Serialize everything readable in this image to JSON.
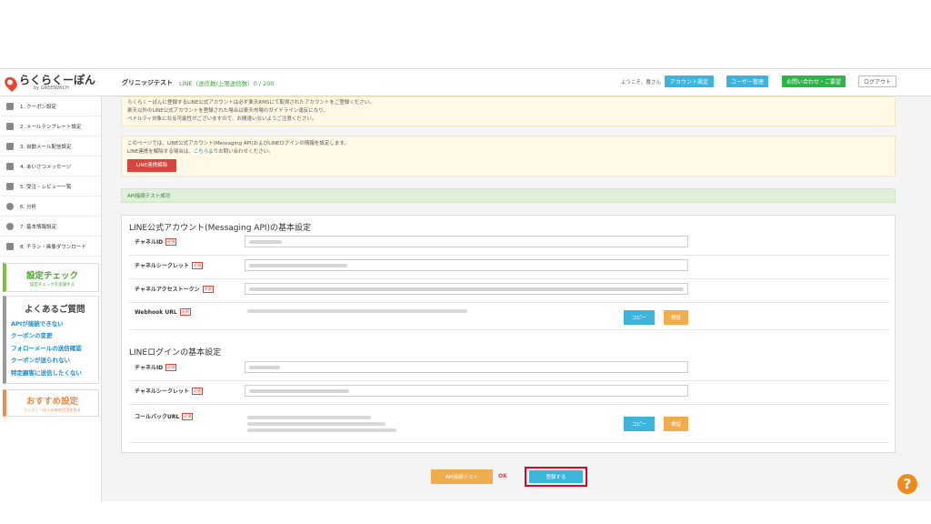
{
  "header": {
    "logo_text": "らくらくーぽん",
    "logo_sub": "by GREENWICH",
    "shop_name": "グリニッジテスト",
    "line_usage": "LINE（送信数/上限送信数）0 / 200",
    "welcome": "ようこそ、農さん",
    "account_btn": "アカウント設定",
    "user_btn": "ユーザー管理",
    "contact_btn": "お問い合わせ・ご要望",
    "logout_btn": "ログアウト"
  },
  "sidebar": {
    "items": [
      {
        "label": "1. クーポン設定",
        "icon": "coupon-icon"
      },
      {
        "label": "2. メールテンプレート設定",
        "icon": "mail-icon"
      },
      {
        "label": "3. 自動メール配信設定",
        "icon": "auto-mail-icon"
      },
      {
        "label": "4. あいさつメッセージ",
        "icon": "message-icon"
      },
      {
        "label": "5. 受注・レビュー一覧",
        "icon": "list-icon"
      },
      {
        "label": "6. 分析",
        "icon": "pie-chart-icon"
      },
      {
        "label": "7. 基本情報設定",
        "icon": "gear-icon"
      },
      {
        "label": "8. チラシ・画像ダウンロード",
        "icon": "download-icon"
      }
    ],
    "check": {
      "title": "設定チェック",
      "sub": "設定チェックを実施する"
    },
    "faq": {
      "title": "よくあるご質問",
      "links": [
        "APIが接続できない",
        "クーポンの変更",
        "フォローメールの送信確認",
        "クーポンが送られない",
        "特定顧客に送信したくない"
      ]
    },
    "recommend": {
      "title": "おすすめ設定",
      "sub": "らくらくーぽんの有効活用を見る"
    }
  },
  "notice1": {
    "line1": "らくらくーぽんに登録するLINE公式アカウントは必ず楽天RMSにて取得されたアカウントをご登録ください。",
    "line2": "楽天以外のLINE公式アカウントを登録された場合は楽天市場のガイドライン違反になり、",
    "line3": "ペナルティ対象になる可能性がございますので、お間違いないようご注意ください。"
  },
  "notice2": {
    "line1": "このページでは、LINE公式アカウント(Messaging API)およびLINEログインの情報を設定します。",
    "line2_pre": "LINE連携を解除する場合は、",
    "line2_link": "こちら",
    "line2_post": "よりお問い合わせください。",
    "unlink_btn": "LINE連携解除"
  },
  "api_success": "API接続テスト成功",
  "messaging": {
    "title": "LINE公式アカウント(Messaging API)の基本設定",
    "required": "必須",
    "channel_id": "チャネルID",
    "channel_secret": "チャネルシークレット",
    "access_token": "チャネルアクセストークン",
    "webhook": "Webhook URL",
    "copy_btn": "コピー",
    "verify_btn": "検証"
  },
  "login": {
    "title": "LINEログインの基本設定",
    "channel_id": "チャネルID",
    "channel_secret": "チャネルシークレット",
    "callback": "コールバックURL",
    "copy_btn": "コピー",
    "verify_btn": "検証"
  },
  "footer": {
    "api_test_btn": "API接続テスト",
    "ok": "OK",
    "register_btn": "登録する"
  },
  "help": "?"
}
